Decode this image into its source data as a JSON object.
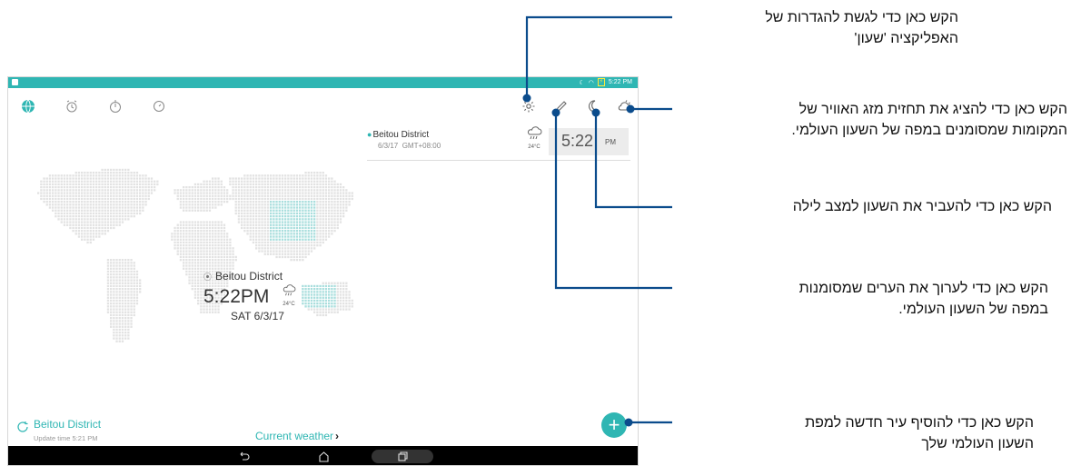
{
  "status_bar": {
    "time": "5:22 PM",
    "battery_label": "⚡"
  },
  "toolbar": {
    "tabs": [
      "world-clock",
      "alarm",
      "stopwatch",
      "timer"
    ],
    "actions": [
      "settings",
      "edit",
      "night-mode",
      "weather"
    ]
  },
  "city_card": {
    "city": "Beitou District",
    "date": "6/3/17",
    "gmt": "GMT+08:00",
    "temp": "24°C",
    "time": "5:22",
    "ampm": "PM"
  },
  "map_label": {
    "city": "Beitou District",
    "time": "5:22PM",
    "temp": "24°C",
    "date": "SAT 6/3/17"
  },
  "bottom": {
    "city": "Beitou District",
    "update": "Update time 5:21 PM",
    "current_weather": "Current weather"
  },
  "colors": {
    "accent": "#2fb6b3",
    "line": "#0b4c8c"
  },
  "callouts": {
    "settings": [
      "הקש כאן כדי לגשת להגדרות של",
      "האפליקציה 'שעון'"
    ],
    "weather": [
      "הקש כאן כדי להציג את תחזית מזג האוויר של",
      "המקומות שמסומנים במפה של השעון העולמי."
    ],
    "night": [
      "הקש כאן כדי להעביר את השעון למצב לילה"
    ],
    "edit": [
      "הקש כאן כדי לערוך את הערים שמסומנות",
      "במפה של השעון העולמי."
    ],
    "add": [
      "הקש כאן כדי להוסיף עיר חדשה למפת",
      "השעון העולמי שלך"
    ]
  }
}
